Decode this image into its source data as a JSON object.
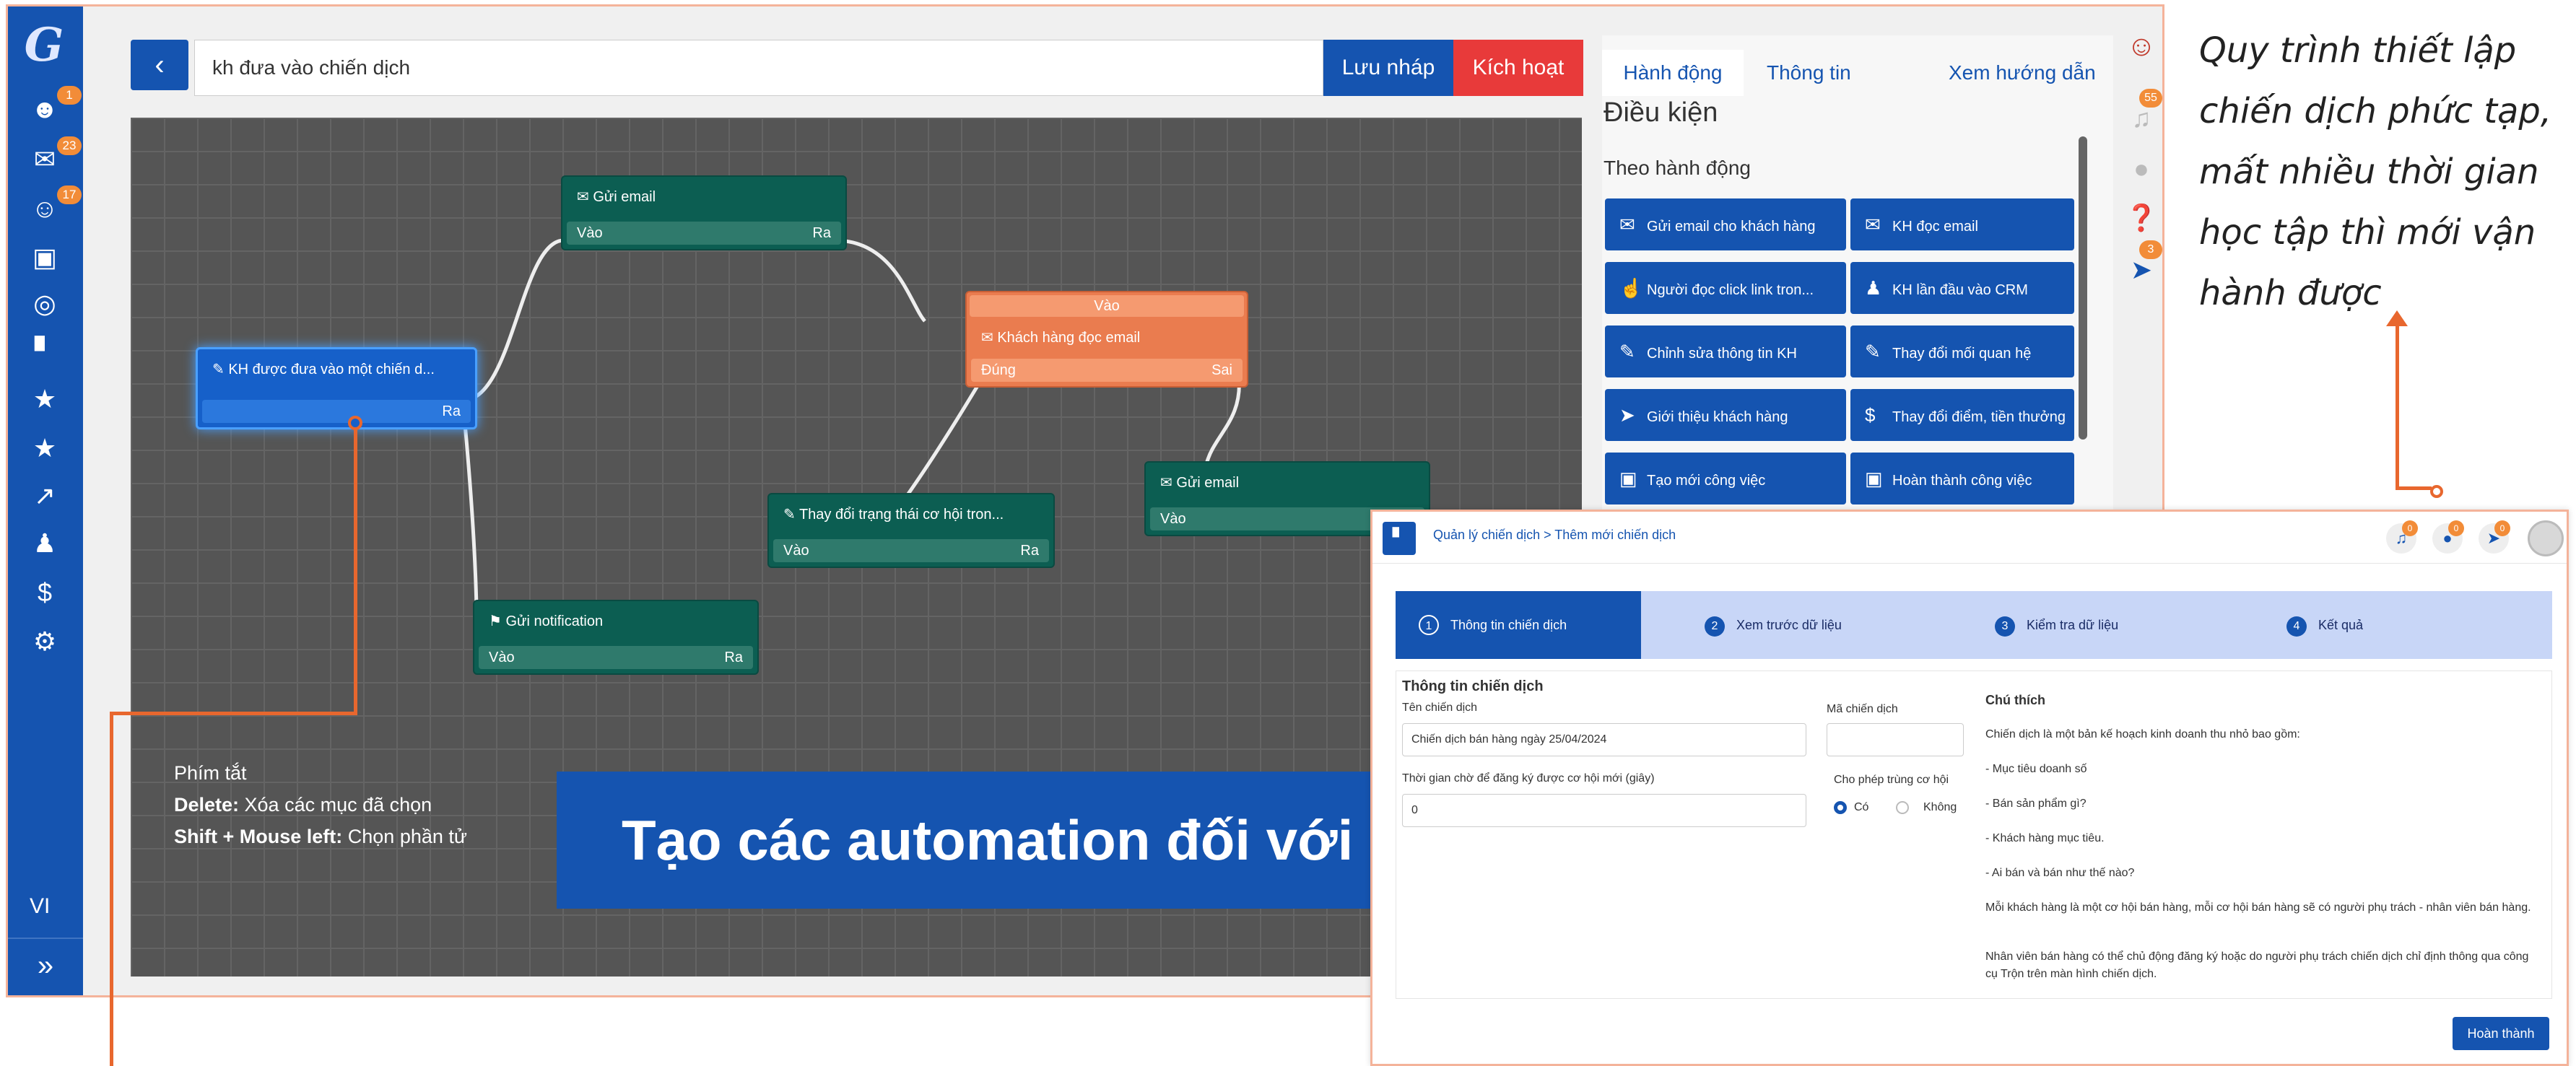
{
  "top_bar": {
    "campaign_input_value": "kh đưa vào chiến dịch",
    "save_draft_label": "Lưu nháp",
    "activate_label": "Kích hoạt"
  },
  "sidebar": {
    "badges": [
      "1",
      "23",
      "17"
    ],
    "language": "VI",
    "more": "»"
  },
  "nodes": {
    "start": {
      "title": "KH được đưa vào một chiến d...",
      "out": "Ra"
    },
    "email1": {
      "title": "Gửi email",
      "in": "Vào",
      "out": "Ra"
    },
    "read_email": {
      "title": "Khách hàng đọc email",
      "in": "Vào",
      "true": "Đúng",
      "false": "Sai"
    },
    "change_status": {
      "title": "Thay đổi trạng thái cơ hội tron...",
      "in": "Vào",
      "out": "Ra"
    },
    "email2": {
      "title": "Gửi email",
      "in": "Vào"
    },
    "notification": {
      "title": "Gửi notification",
      "in": "Vào",
      "out": "Ra"
    }
  },
  "shortcuts": {
    "heading": "Phím tắt",
    "delete_key": "Delete:",
    "delete_desc": " Xóa các mục đã chọn",
    "shift_key": "Shift + Mouse left:",
    "shift_desc": " Chọn phần tử"
  },
  "banner_text": "Tạo các automation đối với khách hàng",
  "right_panel": {
    "tabs": [
      "Hành động",
      "Thông tin",
      "Xem hướng dẫn"
    ],
    "title": "Điều kiện",
    "subtitle": "Theo hành động",
    "actions": [
      "Gửi email cho khách hàng",
      "KH đọc email",
      "Người đọc click link tron...",
      "KH lần đầu vào CRM",
      "Chỉnh sửa thông tin KH",
      "Thay đổi mối quan hệ",
      "Giới thiệu khách hàng",
      "Thay đổi điểm, tiền thưởng",
      "Tạo mới công việc",
      "Hoàn thành công việc"
    ]
  },
  "right_icons": {
    "bell_badge": "55",
    "rocket_badge": "3"
  },
  "annotation": "Quy trình thiết lập chiến dịch phức tạp, mất nhiều thời gian học tập thì mới vận hành được",
  "wizard": {
    "breadcrumb": "Quản lý chiến dịch  >  Thêm mới chiến dịch",
    "badges": [
      "0",
      "0",
      "0"
    ],
    "steps": [
      {
        "n": "1",
        "label": "Thông tin chiến dịch"
      },
      {
        "n": "2",
        "label": "Xem trước dữ liệu"
      },
      {
        "n": "3",
        "label": "Kiểm tra dữ liệu"
      },
      {
        "n": "4",
        "label": "Kết quả"
      }
    ],
    "section_title": "Thông tin chiến dịch",
    "name_label": "Tên chiến dịch",
    "name_value": "Chiến dịch bán hàng ngày 25/04/2024",
    "code_label": "Mã chiến dịch",
    "code_value": "",
    "wait_label": "Thời gian chờ để đăng ký được cơ hội mới (giây)",
    "wait_value": "0",
    "dup_label": "Cho phép trùng cơ hội",
    "dup_yes": "Có",
    "dup_no": "Không",
    "note_title": "Chú thích",
    "notes": [
      "Chiến dịch là một bản kế hoạch kinh doanh thu nhỏ bao gồm:",
      "- Mục tiêu doanh số",
      "- Bán sản phẩm gì?",
      "- Khách hàng mục tiêu.",
      "- Ai bán và bán như thế nào?",
      "Mỗi khách hàng là một cơ hội bán hàng, mỗi cơ hội bán hàng sẽ có người phụ trách - nhân viên bán hàng.",
      "Nhân viên bán hàng có thể chủ động đăng ký hoặc do người phụ trách chiến dịch chỉ định thông qua công cụ Trộn trên màn hình chiến dịch."
    ],
    "done_label": "Hoàn thành"
  }
}
